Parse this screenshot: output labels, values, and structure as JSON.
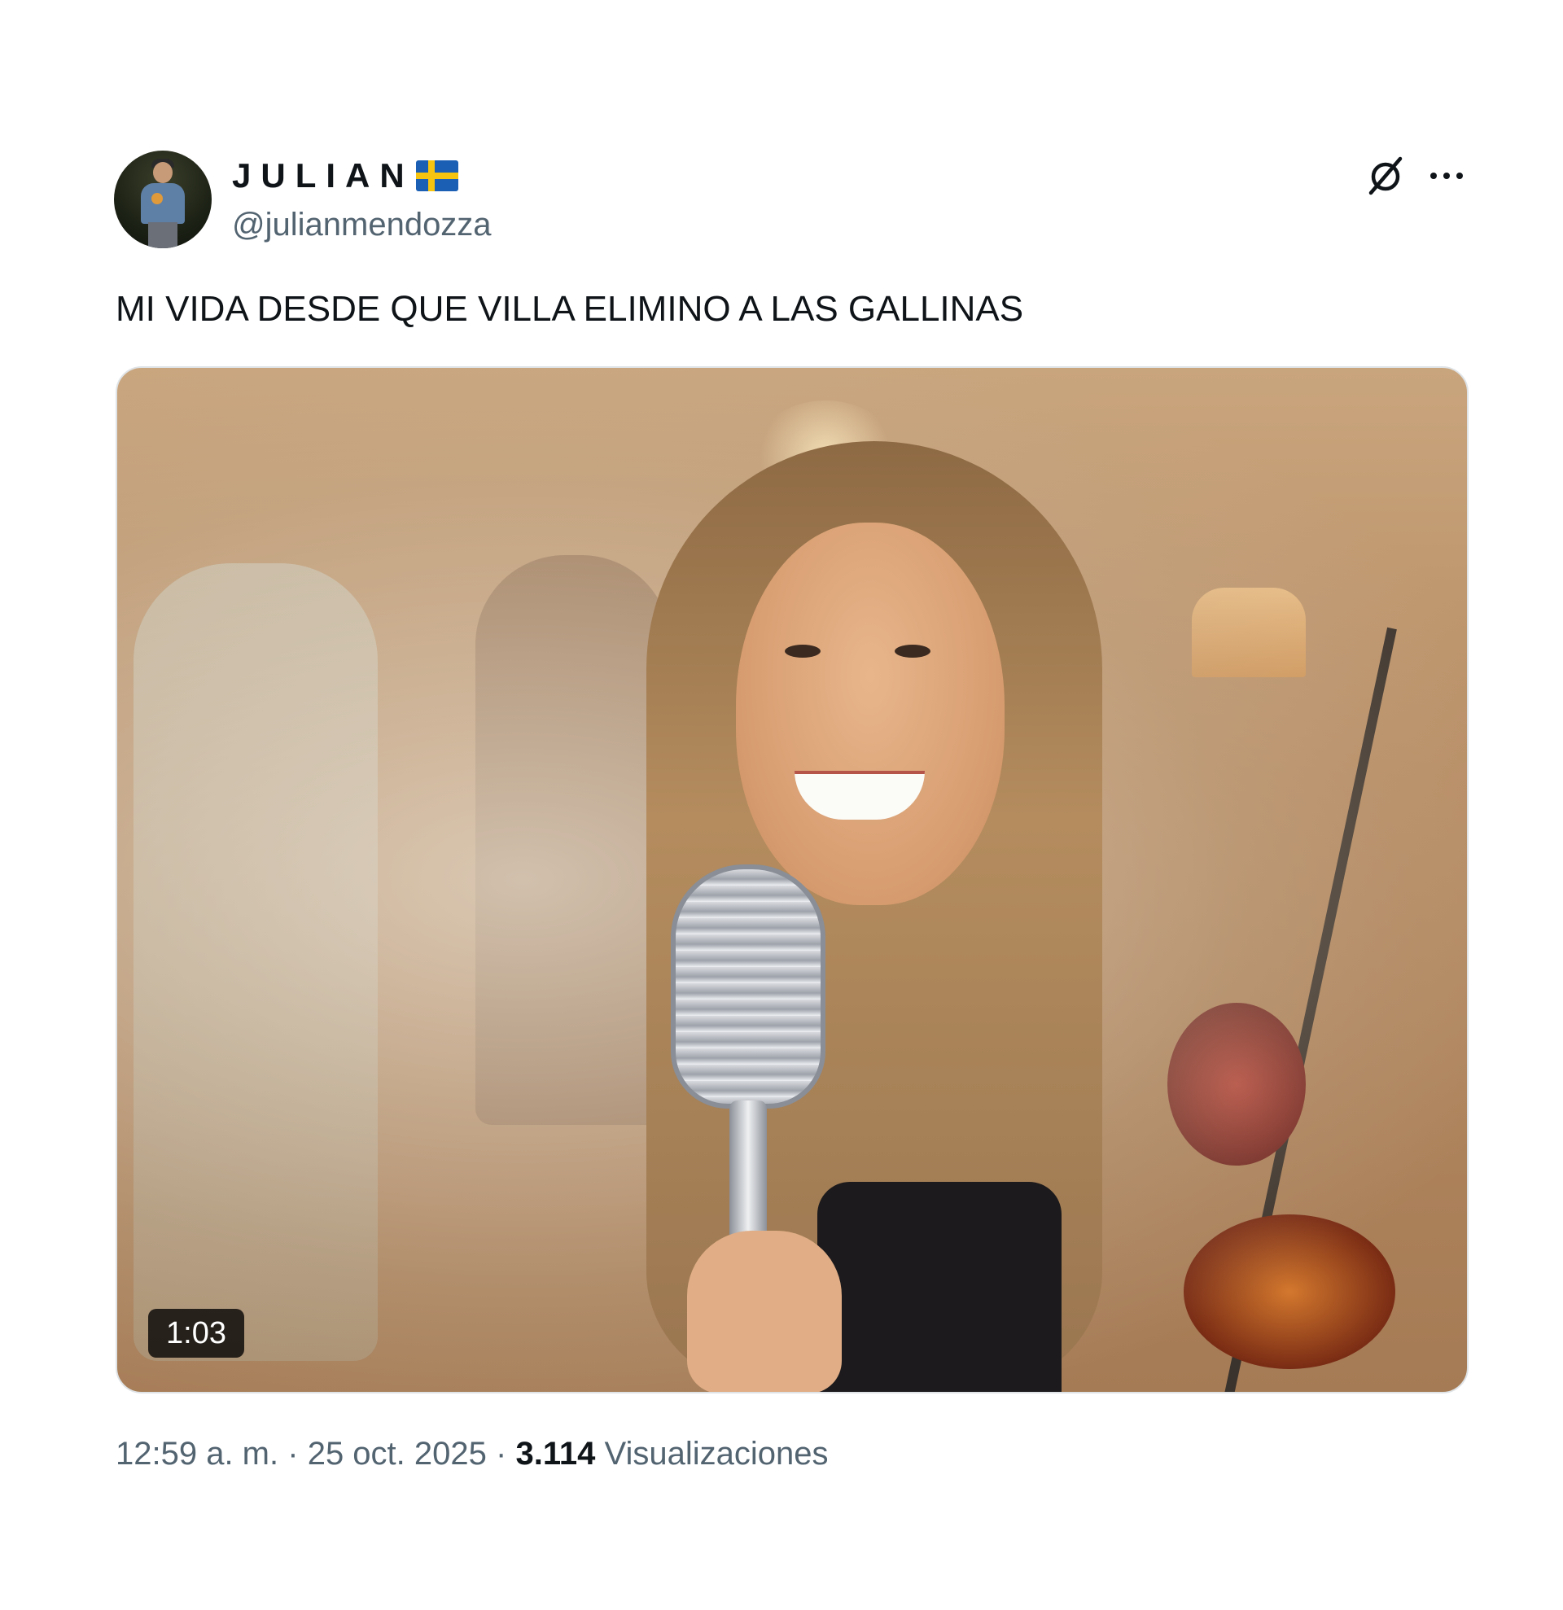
{
  "author": {
    "display_name": "JULIAN",
    "handle": "@julianmendozza",
    "flag_icon": "sweden-flag-icon"
  },
  "header_actions": {
    "grok_icon": "grok-icon",
    "more_icon": "more-dots-icon"
  },
  "tweet": {
    "text": "MI VIDA DESDE QUE VILLA ELIMINO A LAS GALLINAS"
  },
  "media": {
    "type": "video",
    "duration": "1:03"
  },
  "meta": {
    "time": "12:59 a. m.",
    "separator": "·",
    "date": "25 oct. 2025",
    "views_count": "3.114",
    "views_label": "Visualizaciones"
  },
  "colors": {
    "text_primary": "#0f1419",
    "text_secondary": "#536471",
    "flag_blue": "#1a5fb4",
    "flag_yellow": "#f6c40e"
  }
}
